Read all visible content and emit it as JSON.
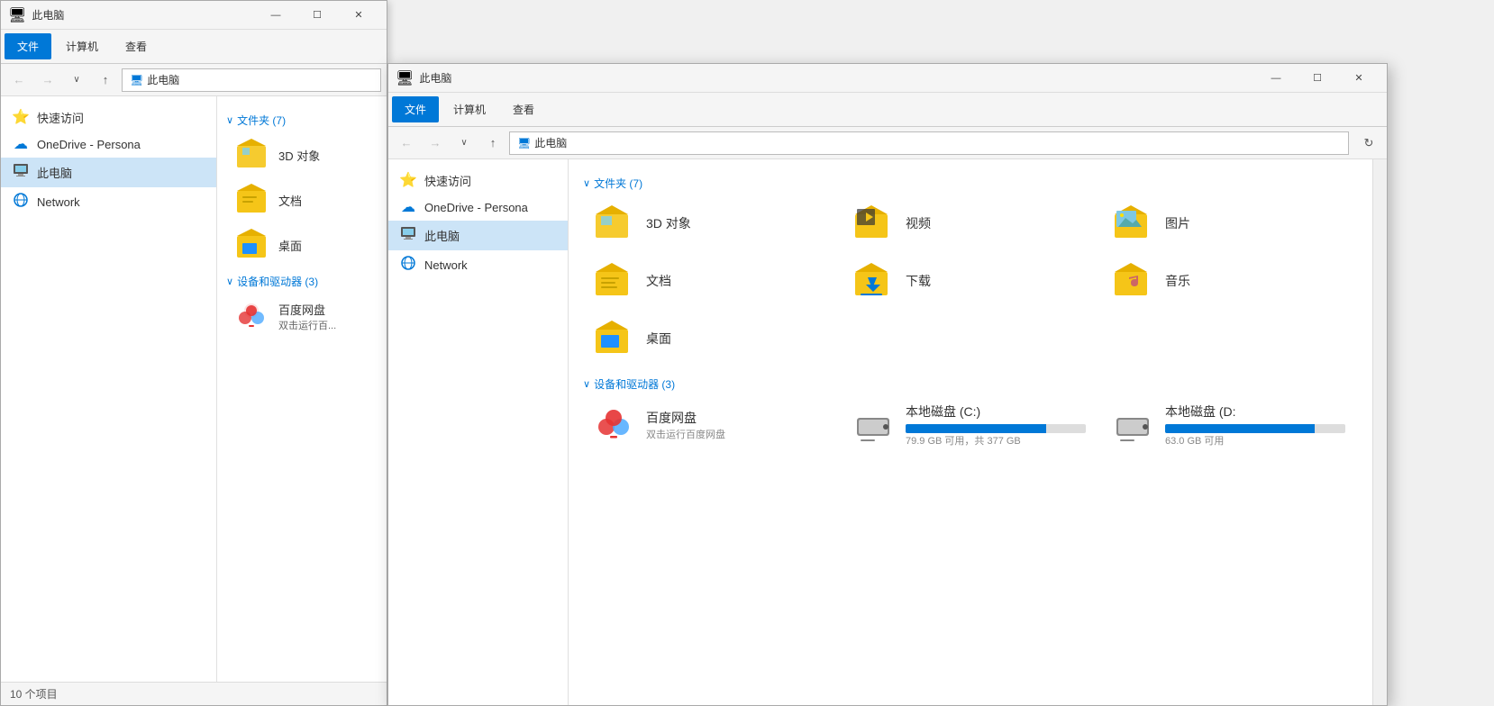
{
  "window1": {
    "title": "此电脑",
    "tabs": [
      "文件",
      "计算机",
      "查看"
    ],
    "active_tab": "文件",
    "address": "此电脑",
    "nav": {
      "back_disabled": true,
      "forward_disabled": true
    },
    "sidebar": {
      "items": [
        {
          "label": "快速访问",
          "icon": "⭐"
        },
        {
          "label": "OneDrive - Persona",
          "icon": "☁"
        },
        {
          "label": "此电脑",
          "icon": "💻",
          "active": true
        },
        {
          "label": "Network",
          "icon": "🌐"
        }
      ]
    },
    "sections": [
      {
        "header": "文件夹 (7)",
        "items": [
          {
            "label": "3D 对象",
            "type": "folder3d"
          },
          {
            "label": "文档",
            "type": "folder-doc"
          },
          {
            "label": "桌面",
            "type": "folder-desktop"
          }
        ]
      },
      {
        "header": "设备和驱动器 (3)",
        "items": [
          {
            "label": "百度网盘",
            "sublabel": "双击运行百...",
            "type": "baidu"
          }
        ]
      }
    ],
    "statusbar": "10 个项目"
  },
  "window2": {
    "title": "此电脑",
    "tabs": [
      "文件",
      "计算机",
      "查看"
    ],
    "active_tab": "文件",
    "address": "此电脑",
    "sidebar": {
      "items": [
        {
          "label": "快速访问",
          "icon": "⭐"
        },
        {
          "label": "OneDrive - Persona",
          "icon": "☁"
        },
        {
          "label": "此电脑",
          "icon": "💻",
          "active": true
        },
        {
          "label": "Network",
          "icon": "🌐"
        }
      ]
    },
    "sections": [
      {
        "header": "文件夹 (7)",
        "items": [
          {
            "label": "3D 对象",
            "type": "folder3d"
          },
          {
            "label": "视频",
            "type": "folder-video"
          },
          {
            "label": "图片",
            "type": "folder-picture"
          },
          {
            "label": "文档",
            "type": "folder-doc"
          },
          {
            "label": "下载",
            "type": "folder-download"
          },
          {
            "label": "音乐",
            "type": "folder-music"
          },
          {
            "label": "桌面",
            "type": "folder-desktop"
          }
        ]
      },
      {
        "header": "设备和驱动器 (3)",
        "items": [
          {
            "label": "百度网盘",
            "sublabel": "双击运行百度网盘",
            "type": "baidu"
          },
          {
            "label": "本地磁盘 (C:)",
            "sublabel": "79.9 GB 可用，共 377 GB",
            "type": "drive-c",
            "pct": 78
          },
          {
            "label": "本地磁盘 (D:",
            "sublabel": "63.0 GB 可用",
            "type": "drive-d",
            "pct": 85
          }
        ]
      }
    ]
  }
}
